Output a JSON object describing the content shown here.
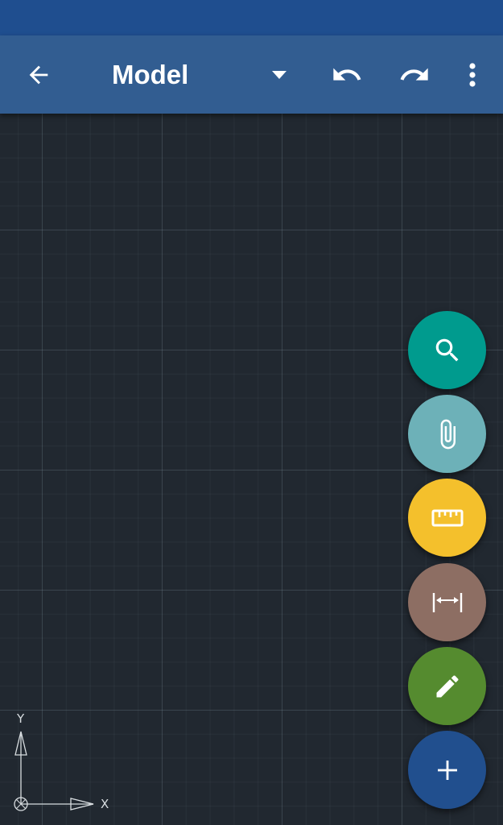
{
  "header": {
    "title": "Model",
    "status_bar_color": "#1f4e8f",
    "app_bar_color": "#325d91"
  },
  "toolbar": {
    "back_icon": "arrow-left-icon",
    "dropdown_icon": "triangle-down-icon",
    "undo_icon": "undo-icon",
    "redo_icon": "redo-icon",
    "more_icon": "more-vertical-icon"
  },
  "canvas": {
    "background_color": "#212830",
    "grid": true,
    "ucs": {
      "x_label": "X",
      "y_label": "Y"
    }
  },
  "fabs": [
    {
      "icon": "search-icon",
      "color": "#009b8e"
    },
    {
      "icon": "paperclip-icon",
      "color": "#6db1b8"
    },
    {
      "icon": "ruler-icon",
      "color": "#f4c02c"
    },
    {
      "icon": "dimension-icon",
      "color": "#8d6e63"
    },
    {
      "icon": "pencil-icon",
      "color": "#558b2f"
    },
    {
      "icon": "plus-icon",
      "color": "#214f8e"
    }
  ]
}
